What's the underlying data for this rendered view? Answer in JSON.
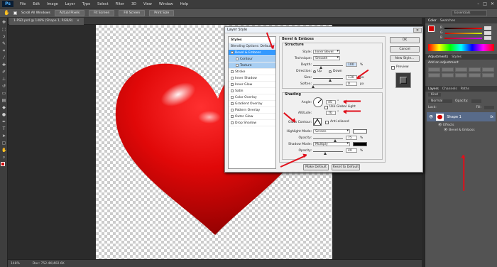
{
  "menubar": {
    "logo": "Ps",
    "items": [
      "File",
      "Edit",
      "Image",
      "Layer",
      "Type",
      "Select",
      "Filter",
      "3D",
      "View",
      "Window",
      "Help"
    ],
    "window_controls": [
      "–",
      "□",
      "✕"
    ]
  },
  "options_bar": {
    "scroll_all_label": "Scroll All Windows",
    "buttons": [
      "Actual Pixels",
      "Fit Screen",
      "Fill Screen",
      "Print Size"
    ],
    "workspace": "Essentials"
  },
  "document": {
    "tab_title": "1-PSD.psd @ 148% (Shape 1, RGB/8)",
    "close": "×"
  },
  "status": {
    "zoom": "148%",
    "doc": "Doc: 752.4K/402.6K"
  },
  "right_panel": {
    "color_tabs": [
      "Color",
      "Swatches"
    ],
    "slider_labels": [
      "R",
      "G",
      "B"
    ],
    "adjustments_tabs": [
      "Adjustments",
      "Styles"
    ],
    "add_adjustment": "Add an adjustment",
    "layers_tabs": [
      "Layers",
      "Channels",
      "Paths"
    ],
    "kind": "Kind",
    "blend_mode": "Normal",
    "opacity_label": "Opacity:",
    "lock_label": "Lock:",
    "fill_label": "Fill:",
    "layer_name": "Shape 1",
    "fx": "fx",
    "effects_label": "Effects",
    "effect_name": "Bevel & Emboss"
  },
  "dialog": {
    "title": "Layer Style",
    "close": "✕",
    "styles_header": "Styles",
    "styles": [
      {
        "label": "Blending Options: Default",
        "state": "header"
      },
      {
        "label": "Bevel & Emboss",
        "state": "selected",
        "checked": true
      },
      {
        "label": "Contour",
        "state": "sub"
      },
      {
        "label": "Texture",
        "state": "sub"
      },
      {
        "label": "Stroke",
        "state": "normal"
      },
      {
        "label": "Inner Shadow",
        "state": "normal"
      },
      {
        "label": "Inner Glow",
        "state": "normal"
      },
      {
        "label": "Satin",
        "state": "normal"
      },
      {
        "label": "Color Overlay",
        "state": "normal"
      },
      {
        "label": "Gradient Overlay",
        "state": "normal"
      },
      {
        "label": "Pattern Overlay",
        "state": "normal"
      },
      {
        "label": "Outer Glow",
        "state": "normal"
      },
      {
        "label": "Drop Shadow",
        "state": "normal"
      }
    ],
    "bevel_title": "Bevel & Emboss",
    "structure_title": "Structure",
    "style_label": "Style:",
    "style_value": "Inner Bevel",
    "technique_label": "Technique:",
    "technique_value": "Smooth",
    "depth_label": "Depth:",
    "depth_value": "100",
    "direction_label": "Direction:",
    "direction_up": "Up",
    "direction_down": "Down",
    "size_label": "Size:",
    "size_value": "130",
    "soften_label": "Soften:",
    "soften_value": "0",
    "percent": "%",
    "px": "px",
    "shading_title": "Shading",
    "angle_label": "Angle:",
    "angle_value": "45",
    "degree": "°",
    "use_global_light": "Use Global Light",
    "altitude_label": "Altitude:",
    "altitude_value": "70",
    "gloss_contour_label": "Gloss Contour:",
    "anti_aliased": "Anti-aliased",
    "highlight_mode_label": "Highlight Mode:",
    "highlight_mode_value": "Screen",
    "highlight_opacity_label": "Opacity:",
    "highlight_opacity_value": "75",
    "shadow_mode_label": "Shadow Mode:",
    "shadow_mode_value": "Multiply",
    "shadow_opacity_label": "Opacity:",
    "shadow_opacity_value": "40",
    "make_default": "Make Default",
    "reset_default": "Reset to Default",
    "ok": "OK",
    "cancel": "Cancel",
    "new_style": "New Style...",
    "preview": "Preview"
  },
  "colors": {
    "accent": "#3399ff",
    "heart": "#d10000",
    "annotation": "#e0101b"
  }
}
